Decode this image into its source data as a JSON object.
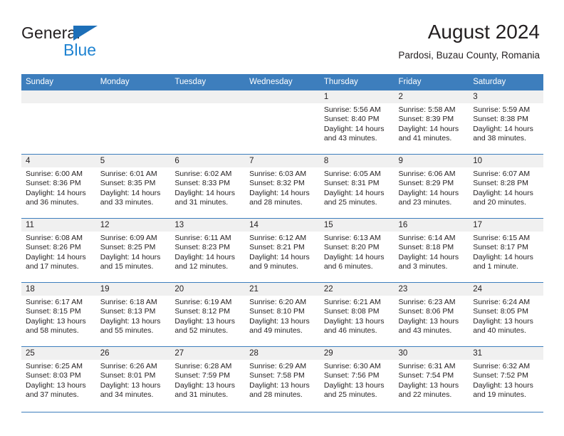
{
  "brand": {
    "name_part1": "General",
    "name_part2": "Blue",
    "triangle_icon": "blue-triangle-icon",
    "colors": {
      "dark": "#231f20",
      "blue": "#1f83d1",
      "triangle": "#1d6fb8"
    }
  },
  "header": {
    "title": "August 2024",
    "subtitle": "Pardosi, Buzau County, Romania"
  },
  "calendar": {
    "header_bg": "#3d7ebd",
    "daynum_bg": "#f0f0f0",
    "grid_line": "#3d7ebd",
    "weekdays": [
      "Sunday",
      "Monday",
      "Tuesday",
      "Wednesday",
      "Thursday",
      "Friday",
      "Saturday"
    ],
    "weeks": [
      [
        {
          "day": "",
          "empty": true
        },
        {
          "day": "",
          "empty": true
        },
        {
          "day": "",
          "empty": true
        },
        {
          "day": "",
          "empty": true
        },
        {
          "day": "1",
          "sunrise": "Sunrise: 5:56 AM",
          "sunset": "Sunset: 8:40 PM",
          "daylight": "Daylight: 14 hours and 43 minutes."
        },
        {
          "day": "2",
          "sunrise": "Sunrise: 5:58 AM",
          "sunset": "Sunset: 8:39 PM",
          "daylight": "Daylight: 14 hours and 41 minutes."
        },
        {
          "day": "3",
          "sunrise": "Sunrise: 5:59 AM",
          "sunset": "Sunset: 8:38 PM",
          "daylight": "Daylight: 14 hours and 38 minutes."
        }
      ],
      [
        {
          "day": "4",
          "sunrise": "Sunrise: 6:00 AM",
          "sunset": "Sunset: 8:36 PM",
          "daylight": "Daylight: 14 hours and 36 minutes."
        },
        {
          "day": "5",
          "sunrise": "Sunrise: 6:01 AM",
          "sunset": "Sunset: 8:35 PM",
          "daylight": "Daylight: 14 hours and 33 minutes."
        },
        {
          "day": "6",
          "sunrise": "Sunrise: 6:02 AM",
          "sunset": "Sunset: 8:33 PM",
          "daylight": "Daylight: 14 hours and 31 minutes."
        },
        {
          "day": "7",
          "sunrise": "Sunrise: 6:03 AM",
          "sunset": "Sunset: 8:32 PM",
          "daylight": "Daylight: 14 hours and 28 minutes."
        },
        {
          "day": "8",
          "sunrise": "Sunrise: 6:05 AM",
          "sunset": "Sunset: 8:31 PM",
          "daylight": "Daylight: 14 hours and 25 minutes."
        },
        {
          "day": "9",
          "sunrise": "Sunrise: 6:06 AM",
          "sunset": "Sunset: 8:29 PM",
          "daylight": "Daylight: 14 hours and 23 minutes."
        },
        {
          "day": "10",
          "sunrise": "Sunrise: 6:07 AM",
          "sunset": "Sunset: 8:28 PM",
          "daylight": "Daylight: 14 hours and 20 minutes."
        }
      ],
      [
        {
          "day": "11",
          "sunrise": "Sunrise: 6:08 AM",
          "sunset": "Sunset: 8:26 PM",
          "daylight": "Daylight: 14 hours and 17 minutes."
        },
        {
          "day": "12",
          "sunrise": "Sunrise: 6:09 AM",
          "sunset": "Sunset: 8:25 PM",
          "daylight": "Daylight: 14 hours and 15 minutes."
        },
        {
          "day": "13",
          "sunrise": "Sunrise: 6:11 AM",
          "sunset": "Sunset: 8:23 PM",
          "daylight": "Daylight: 14 hours and 12 minutes."
        },
        {
          "day": "14",
          "sunrise": "Sunrise: 6:12 AM",
          "sunset": "Sunset: 8:21 PM",
          "daylight": "Daylight: 14 hours and 9 minutes."
        },
        {
          "day": "15",
          "sunrise": "Sunrise: 6:13 AM",
          "sunset": "Sunset: 8:20 PM",
          "daylight": "Daylight: 14 hours and 6 minutes."
        },
        {
          "day": "16",
          "sunrise": "Sunrise: 6:14 AM",
          "sunset": "Sunset: 8:18 PM",
          "daylight": "Daylight: 14 hours and 3 minutes."
        },
        {
          "day": "17",
          "sunrise": "Sunrise: 6:15 AM",
          "sunset": "Sunset: 8:17 PM",
          "daylight": "Daylight: 14 hours and 1 minute."
        }
      ],
      [
        {
          "day": "18",
          "sunrise": "Sunrise: 6:17 AM",
          "sunset": "Sunset: 8:15 PM",
          "daylight": "Daylight: 13 hours and 58 minutes."
        },
        {
          "day": "19",
          "sunrise": "Sunrise: 6:18 AM",
          "sunset": "Sunset: 8:13 PM",
          "daylight": "Daylight: 13 hours and 55 minutes."
        },
        {
          "day": "20",
          "sunrise": "Sunrise: 6:19 AM",
          "sunset": "Sunset: 8:12 PM",
          "daylight": "Daylight: 13 hours and 52 minutes."
        },
        {
          "day": "21",
          "sunrise": "Sunrise: 6:20 AM",
          "sunset": "Sunset: 8:10 PM",
          "daylight": "Daylight: 13 hours and 49 minutes."
        },
        {
          "day": "22",
          "sunrise": "Sunrise: 6:21 AM",
          "sunset": "Sunset: 8:08 PM",
          "daylight": "Daylight: 13 hours and 46 minutes."
        },
        {
          "day": "23",
          "sunrise": "Sunrise: 6:23 AM",
          "sunset": "Sunset: 8:06 PM",
          "daylight": "Daylight: 13 hours and 43 minutes."
        },
        {
          "day": "24",
          "sunrise": "Sunrise: 6:24 AM",
          "sunset": "Sunset: 8:05 PM",
          "daylight": "Daylight: 13 hours and 40 minutes."
        }
      ],
      [
        {
          "day": "25",
          "sunrise": "Sunrise: 6:25 AM",
          "sunset": "Sunset: 8:03 PM",
          "daylight": "Daylight: 13 hours and 37 minutes."
        },
        {
          "day": "26",
          "sunrise": "Sunrise: 6:26 AM",
          "sunset": "Sunset: 8:01 PM",
          "daylight": "Daylight: 13 hours and 34 minutes."
        },
        {
          "day": "27",
          "sunrise": "Sunrise: 6:28 AM",
          "sunset": "Sunset: 7:59 PM",
          "daylight": "Daylight: 13 hours and 31 minutes."
        },
        {
          "day": "28",
          "sunrise": "Sunrise: 6:29 AM",
          "sunset": "Sunset: 7:58 PM",
          "daylight": "Daylight: 13 hours and 28 minutes."
        },
        {
          "day": "29",
          "sunrise": "Sunrise: 6:30 AM",
          "sunset": "Sunset: 7:56 PM",
          "daylight": "Daylight: 13 hours and 25 minutes."
        },
        {
          "day": "30",
          "sunrise": "Sunrise: 6:31 AM",
          "sunset": "Sunset: 7:54 PM",
          "daylight": "Daylight: 13 hours and 22 minutes."
        },
        {
          "day": "31",
          "sunrise": "Sunrise: 6:32 AM",
          "sunset": "Sunset: 7:52 PM",
          "daylight": "Daylight: 13 hours and 19 minutes."
        }
      ]
    ]
  }
}
